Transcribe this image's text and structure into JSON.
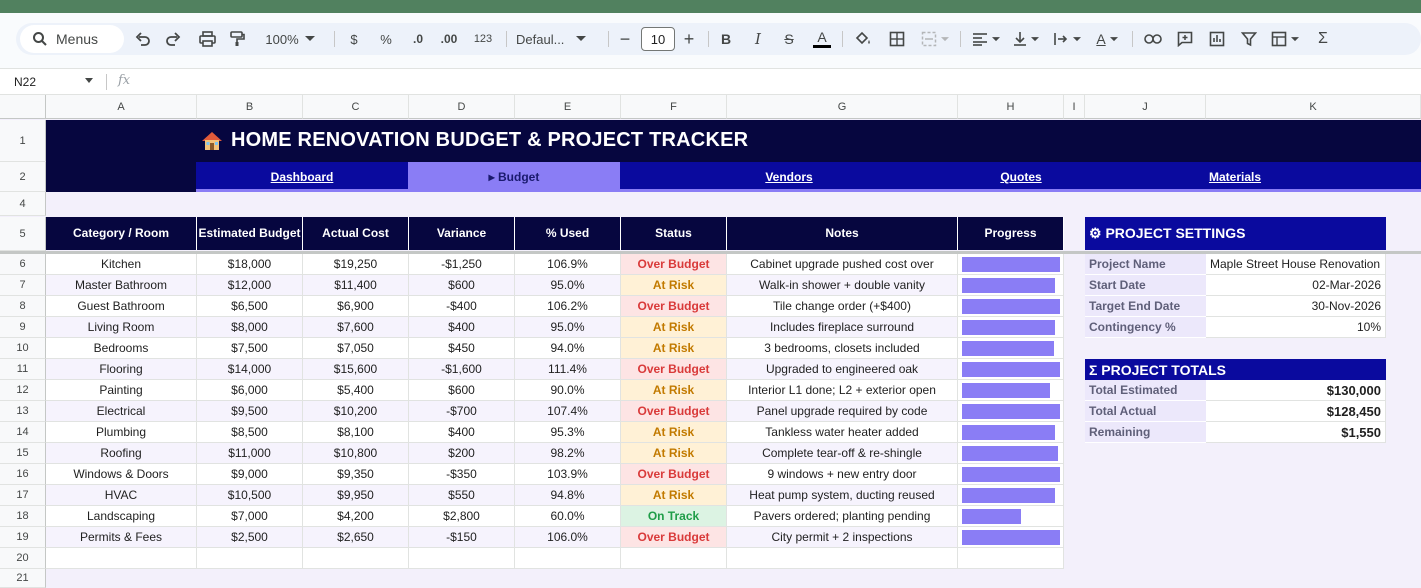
{
  "toolbar": {
    "menus_label": "Menus",
    "zoom": "100%",
    "currency": "$",
    "percent": "%",
    "dec_decrease": ".0",
    "dec_increase": ".00",
    "number_format": "123",
    "font_name": "Defaul...",
    "font_size": "10",
    "minus": "−",
    "plus": "+"
  },
  "formula_bar": {
    "cell_ref": "N22",
    "fx": "fx",
    "value": ""
  },
  "columns": [
    "A",
    "B",
    "C",
    "D",
    "E",
    "F",
    "G",
    "H",
    "I",
    "J",
    "K"
  ],
  "rows": [
    "1",
    "2",
    "4",
    "5",
    "6",
    "7",
    "8",
    "9",
    "10",
    "11",
    "12",
    "13",
    "14",
    "15",
    "16",
    "17",
    "18",
    "19",
    "20",
    "21"
  ],
  "banner": {
    "title": "HOME RENOVATION BUDGET & PROJECT TRACKER"
  },
  "nav": {
    "dashboard": "Dashboard",
    "budget": "▸ Budget",
    "vendors": "Vendors",
    "quotes": "Quotes",
    "materials": "Materials"
  },
  "table": {
    "headers": {
      "category": "Category / Room",
      "estimated": "Estimated Budget",
      "actual": "Actual Cost",
      "variance": "Variance",
      "used": "% Used",
      "status": "Status",
      "notes": "Notes",
      "progress": "Progress"
    },
    "rows": [
      {
        "category": "Kitchen",
        "estimated": "$18,000",
        "actual": "$19,250",
        "variance": "-$1,250",
        "used": "106.9%",
        "status": "Over Budget",
        "notes": "Cabinet upgrade pushed cost over",
        "progress": 1.0
      },
      {
        "category": "Master Bathroom",
        "estimated": "$12,000",
        "actual": "$11,400",
        "variance": "$600",
        "used": "95.0%",
        "status": "At Risk",
        "notes": "Walk-in shower + double vanity",
        "progress": 0.95
      },
      {
        "category": "Guest Bathroom",
        "estimated": "$6,500",
        "actual": "$6,900",
        "variance": "-$400",
        "used": "106.2%",
        "status": "Over Budget",
        "notes": "Tile change order (+$400)",
        "progress": 1.0
      },
      {
        "category": "Living Room",
        "estimated": "$8,000",
        "actual": "$7,600",
        "variance": "$400",
        "used": "95.0%",
        "status": "At Risk",
        "notes": "Includes fireplace surround",
        "progress": 0.95
      },
      {
        "category": "Bedrooms",
        "estimated": "$7,500",
        "actual": "$7,050",
        "variance": "$450",
        "used": "94.0%",
        "status": "At Risk",
        "notes": "3 bedrooms, closets included",
        "progress": 0.94
      },
      {
        "category": "Flooring",
        "estimated": "$14,000",
        "actual": "$15,600",
        "variance": "-$1,600",
        "used": "111.4%",
        "status": "Over Budget",
        "notes": "Upgraded to engineered oak",
        "progress": 1.0
      },
      {
        "category": "Painting",
        "estimated": "$6,000",
        "actual": "$5,400",
        "variance": "$600",
        "used": "90.0%",
        "status": "At Risk",
        "notes": "Interior L1 done; L2 + exterior open",
        "progress": 0.9
      },
      {
        "category": "Electrical",
        "estimated": "$9,500",
        "actual": "$10,200",
        "variance": "-$700",
        "used": "107.4%",
        "status": "Over Budget",
        "notes": "Panel upgrade required by code",
        "progress": 1.0
      },
      {
        "category": "Plumbing",
        "estimated": "$8,500",
        "actual": "$8,100",
        "variance": "$400",
        "used": "95.3%",
        "status": "At Risk",
        "notes": "Tankless water heater added",
        "progress": 0.953
      },
      {
        "category": "Roofing",
        "estimated": "$11,000",
        "actual": "$10,800",
        "variance": "$200",
        "used": "98.2%",
        "status": "At Risk",
        "notes": "Complete tear-off & re-shingle",
        "progress": 0.982
      },
      {
        "category": "Windows & Doors",
        "estimated": "$9,000",
        "actual": "$9,350",
        "variance": "-$350",
        "used": "103.9%",
        "status": "Over Budget",
        "notes": "9 windows + new entry door",
        "progress": 1.0
      },
      {
        "category": "HVAC",
        "estimated": "$10,500",
        "actual": "$9,950",
        "variance": "$550",
        "used": "94.8%",
        "status": "At Risk",
        "notes": "Heat pump system, ducting reused",
        "progress": 0.948
      },
      {
        "category": "Landscaping",
        "estimated": "$7,000",
        "actual": "$4,200",
        "variance": "$2,800",
        "used": "60.0%",
        "status": "On Track",
        "notes": "Pavers ordered; planting pending",
        "progress": 0.6
      },
      {
        "category": "Permits & Fees",
        "estimated": "$2,500",
        "actual": "$2,650",
        "variance": "-$150",
        "used": "106.0%",
        "status": "Over Budget",
        "notes": "City permit + 2 inspections",
        "progress": 1.0
      }
    ]
  },
  "settings": {
    "title": "⚙ PROJECT SETTINGS",
    "items": [
      {
        "label": "Project Name",
        "value": "Maple Street House Renovation"
      },
      {
        "label": "Start Date",
        "value": "02-Mar-2026"
      },
      {
        "label": "Target End Date",
        "value": "30-Nov-2026"
      },
      {
        "label": "Contingency %",
        "value": "10%"
      }
    ]
  },
  "totals": {
    "title": "Σ PROJECT TOTALS",
    "items": [
      {
        "label": "Total Estimated",
        "value": "$130,000"
      },
      {
        "label": "Total Actual",
        "value": "$128,450"
      },
      {
        "label": "Remaining",
        "value": "$1,550"
      }
    ]
  },
  "colors": {
    "banner": "#06063f",
    "nav": "#0a0a9e",
    "accent": "#8a7df5",
    "over": "#d93a3a",
    "risk": "#c27a00",
    "track": "#1f9d48"
  }
}
